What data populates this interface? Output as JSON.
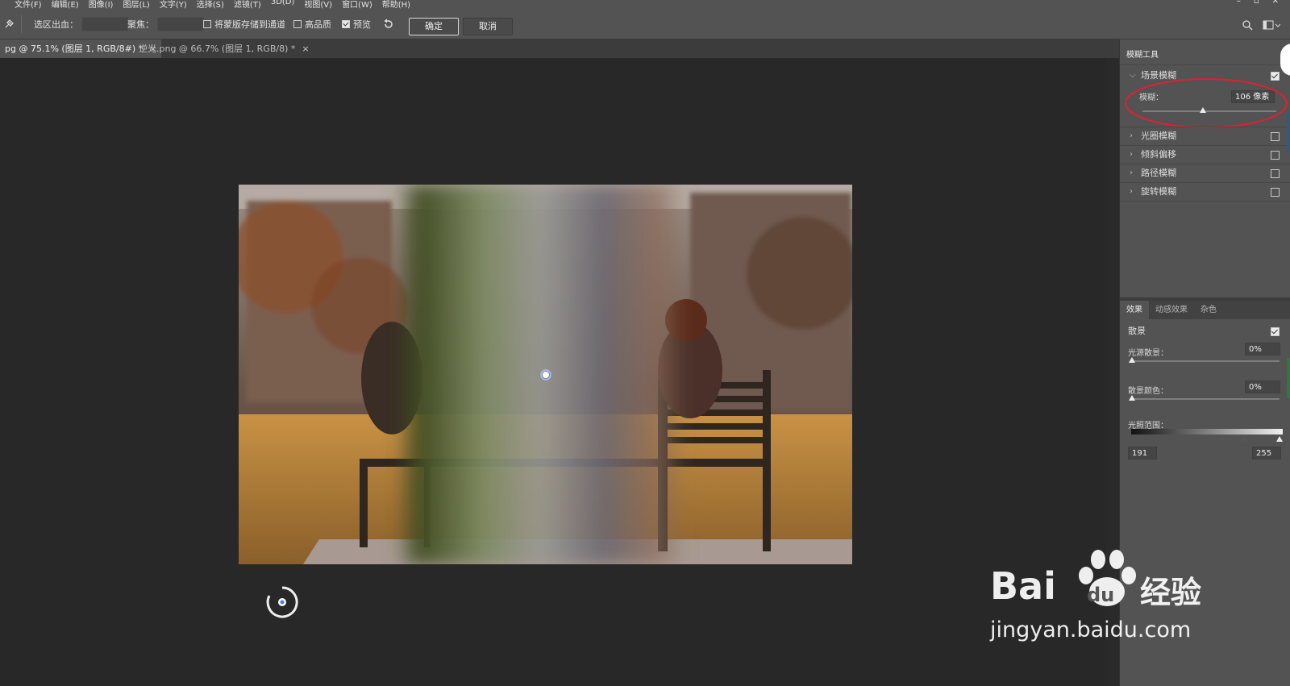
{
  "menubar": {
    "items": [
      "文件(F)",
      "编辑(E)",
      "图像(I)",
      "图层(L)",
      "文字(Y)",
      "选择(S)",
      "滤镜(T)",
      "3D(D)",
      "视图(V)",
      "窗口(W)",
      "帮助(H)"
    ]
  },
  "options_bar": {
    "selection_bleed_label": "选区出血：",
    "focus_label": "聚焦：",
    "save_mask_label": "将蒙版存储到通道",
    "high_quality_label": "高品质",
    "preview_label": "预览",
    "ok_label": "确定",
    "cancel_label": "取消"
  },
  "document_tabs": [
    {
      "label": "pg @ 75.1% (图层 1, RGB/8#) *",
      "active": true
    },
    {
      "label": "逆光.png @ 66.7% (图层 1, RGB/8) *",
      "active": false
    }
  ],
  "blur_tools_panel": {
    "tab_label": "模糊工具",
    "field_blur": {
      "label": "场景模糊",
      "enabled": true,
      "blur_label": "模糊：",
      "blur_value": "106 像素"
    },
    "items": [
      {
        "label": "光圈模糊",
        "enabled": false
      },
      {
        "label": "倾斜偏移",
        "enabled": false
      },
      {
        "label": "路径模糊",
        "enabled": false
      },
      {
        "label": "旋转模糊",
        "enabled": false
      }
    ]
  },
  "effects_panel": {
    "tabs": [
      "效果",
      "动感效果",
      "杂色"
    ],
    "bokeh_label": "散景",
    "bokeh_enabled": true,
    "light_bokeh_label": "光源散景：",
    "light_bokeh_value": "0%",
    "bokeh_color_label": "散景颜色：",
    "bokeh_color_value": "0%",
    "light_range_label": "光照范围：",
    "light_range_min": "191",
    "light_range_max": "255"
  },
  "watermark": {
    "brand": "Bai",
    "brand_tail": "du",
    "cn": "经验",
    "url": "jingyan.baidu.com"
  },
  "colors": {
    "ui_panel": "#535353",
    "canvas": "#282828",
    "annotation": "#e02030"
  },
  "blur_ratio": 0.45,
  "light_range_low_ratio": 0.75,
  "light_range_high_ratio": 1.0
}
